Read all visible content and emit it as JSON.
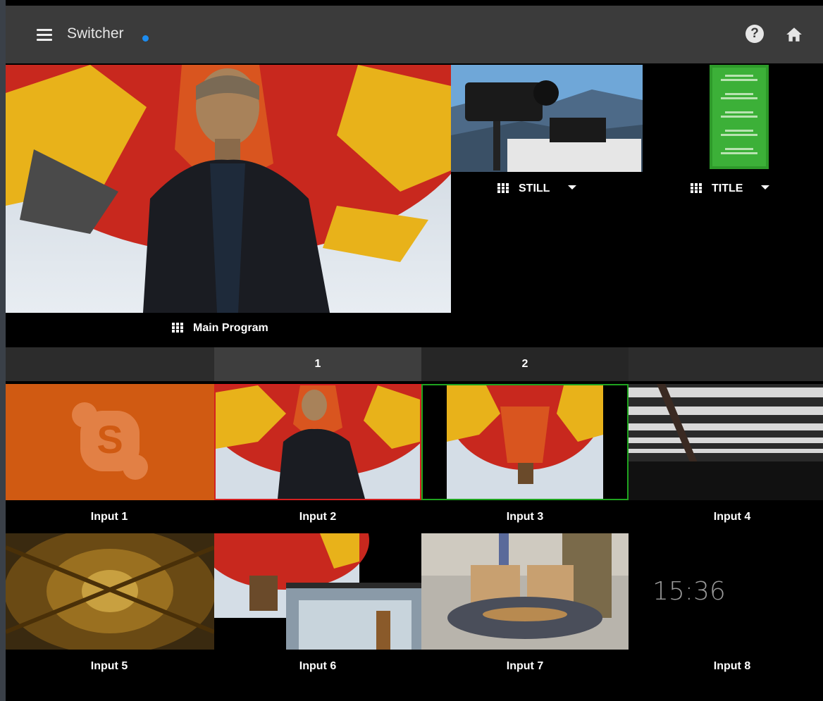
{
  "header": {
    "title": "Switcher",
    "status_dot_color": "#1c8cf0",
    "menu_icon": "hamburger-menu-icon",
    "help_icon": "help-icon",
    "home_icon": "home-icon"
  },
  "program": {
    "label": "Main Program"
  },
  "preview_outputs": [
    {
      "label": "STILL"
    },
    {
      "label": "TITLE"
    }
  ],
  "tabs": [
    {
      "label": "1",
      "active": true
    },
    {
      "label": "2",
      "active": false
    }
  ],
  "inputs": [
    {
      "label": "Input 1",
      "tally": "none"
    },
    {
      "label": "Input 2",
      "tally": "program"
    },
    {
      "label": "Input 3",
      "tally": "preview"
    },
    {
      "label": "Input 4",
      "tally": "none"
    },
    {
      "label": "Input 5",
      "tally": "none"
    },
    {
      "label": "Input 6",
      "tally": "none"
    },
    {
      "label": "Input 7",
      "tally": "none"
    },
    {
      "label": "Input 8",
      "tally": "none",
      "clock": "15:36"
    }
  ],
  "colors": {
    "program_tally": "#d42020",
    "preview_tally": "#1fa31f",
    "skype_orange": "#d05a12",
    "topbar": "#3b3b3b"
  }
}
